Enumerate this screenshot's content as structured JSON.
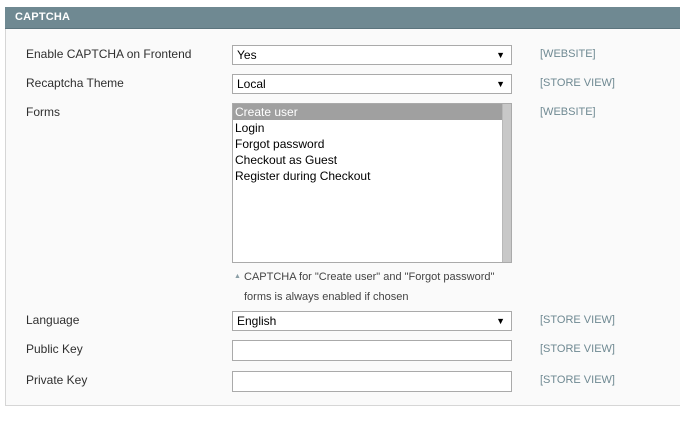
{
  "section": {
    "title": "CAPTCHA"
  },
  "fields": {
    "enable_frontend": {
      "label": "Enable CAPTCHA on Frontend",
      "value": "Yes",
      "scope": "[WEBSITE]"
    },
    "recaptcha_theme": {
      "label": "Recaptcha Theme",
      "value": "Local",
      "scope": "[STORE VIEW]"
    },
    "forms": {
      "label": "Forms",
      "scope": "[WEBSITE]",
      "options": [
        "Create user",
        "Login",
        "Forgot password",
        "Checkout as Guest",
        "Register during Checkout"
      ],
      "selected": "Create user",
      "note": "CAPTCHA for \"Create user\" and \"Forgot password\" forms is always enabled if chosen"
    },
    "language": {
      "label": "Language",
      "value": "English",
      "scope": "[STORE VIEW]"
    },
    "public_key": {
      "label": "Public Key",
      "value": "",
      "scope": "[STORE VIEW]"
    },
    "private_key": {
      "label": "Private Key",
      "value": "",
      "scope": "[STORE VIEW]"
    }
  },
  "icons": {
    "dropdown_arrow": "▼",
    "note_marker": "▲"
  },
  "colors": {
    "header_bg": "#6f8992",
    "scope_text": "#6f8992",
    "selected_option_bg": "#a0a0a0"
  }
}
